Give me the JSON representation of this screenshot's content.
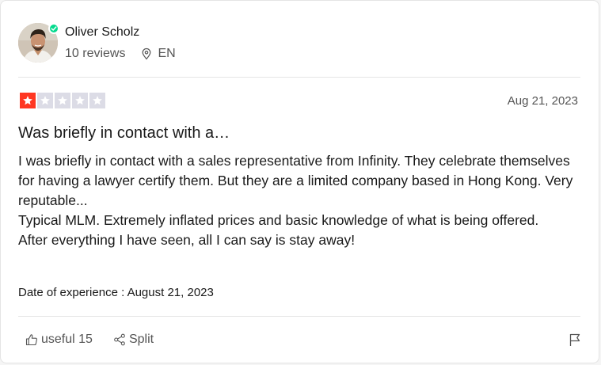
{
  "reviewer": {
    "name": "Oliver Scholz",
    "reviews": "10 reviews",
    "country": "EN"
  },
  "review": {
    "rating": 1,
    "max_rating": 5,
    "date": "Aug 21, 2023",
    "title": "Was briefly in contact with a…",
    "body": [
      "I was briefly in contact with a sales representative from Infinity. They celebrate themselves for having a lawyer certify them. But they are a limited company based in Hong Kong. Very reputable...",
      "Typical MLM. Extremely inflated prices and basic knowledge of what is being offered.",
      "After everything I have seen, all I can say is stay away!"
    ],
    "experience": "Date of experience : August 21, 2023"
  },
  "actions": {
    "useful": "useful 15",
    "share": "Split"
  },
  "colors": {
    "star_active": "#ff3722",
    "star_inactive": "#dcdce6",
    "verified": "#04da8d"
  },
  "icons": {
    "location": "location-pin-icon",
    "useful": "thumbs-up-icon",
    "share": "share-icon",
    "flag": "flag-icon",
    "verified": "checkmark-icon"
  }
}
